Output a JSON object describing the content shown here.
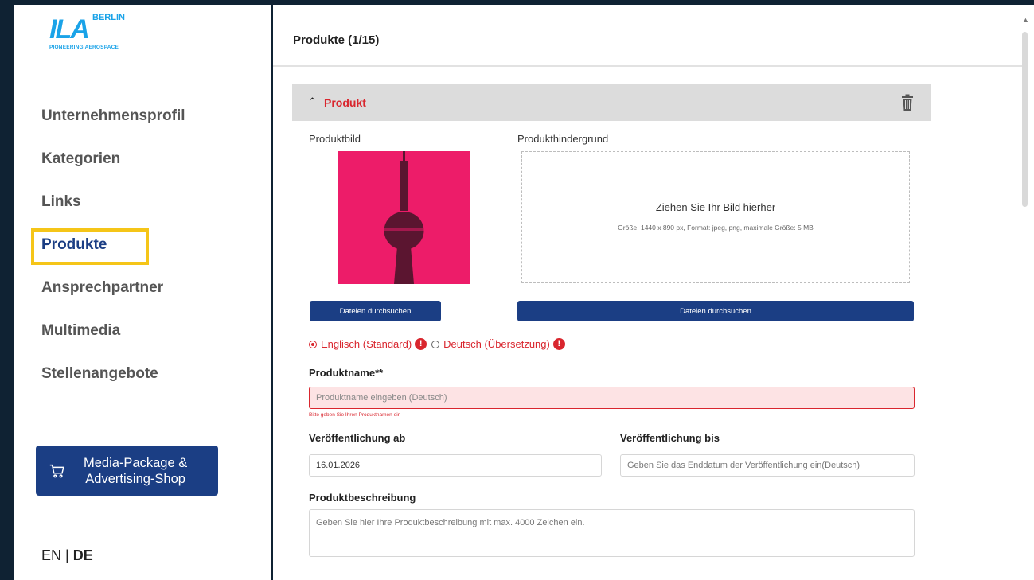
{
  "logo": {
    "mark": "ILA",
    "city": "BERLIN",
    "tagline": "PIONEERING AEROSPACE"
  },
  "sidebar": {
    "items": [
      {
        "label": "Unternehmensprofil"
      },
      {
        "label": "Kategorien"
      },
      {
        "label": "Links"
      },
      {
        "label": "Produkte"
      },
      {
        "label": "Ansprechpartner"
      },
      {
        "label": "Multimedia"
      },
      {
        "label": "Stellenangebote"
      }
    ],
    "active_index": 3,
    "shop_button": {
      "line1": "Media-Package &",
      "line2": "Advertising-Shop",
      "icon": "cart-icon"
    },
    "lang": {
      "en": "EN",
      "sep": " | ",
      "de": "DE"
    }
  },
  "header": {
    "title": "Produkte (1/15)"
  },
  "product": {
    "section_label": "Produkt",
    "image_label": "Produktbild",
    "background_label": "Produkthindergrund",
    "dropzone_title": "Ziehen Sie Ihr Bild hierher",
    "dropzone_hint": "Größe: 1440 x 890 px, Format: jpeg, png, maximale Größe: 5 MB",
    "browse_label_1": "Dateien durchsuchen",
    "browse_label_2": "Dateien durchsuchen",
    "lang_option_1": "Englisch (Standard)",
    "lang_option_2": "Deutsch (Übersetzung)",
    "name_label": "Produktname**",
    "name_placeholder": "Produktname eingeben (Deutsch)",
    "name_error": "Bitte geben Sie Ihren Produktnamen ein",
    "from_label": "Veröffentlichung ab",
    "from_value": "16.01.2026",
    "until_label": "Veröffentlichung bis",
    "until_placeholder": "Geben Sie das Enddatum der Veröffentlichung ein(Deutsch)",
    "desc_label": "Produktbeschreibung",
    "desc_placeholder": "Geben Sie hier Ihre Produktbeschreibung mit max. 4000 Zeichen ein."
  },
  "colors": {
    "accent": "#1b3e84",
    "error": "#d9262e",
    "highlight": "#f5c518",
    "product_bg": "#ed1c69"
  }
}
